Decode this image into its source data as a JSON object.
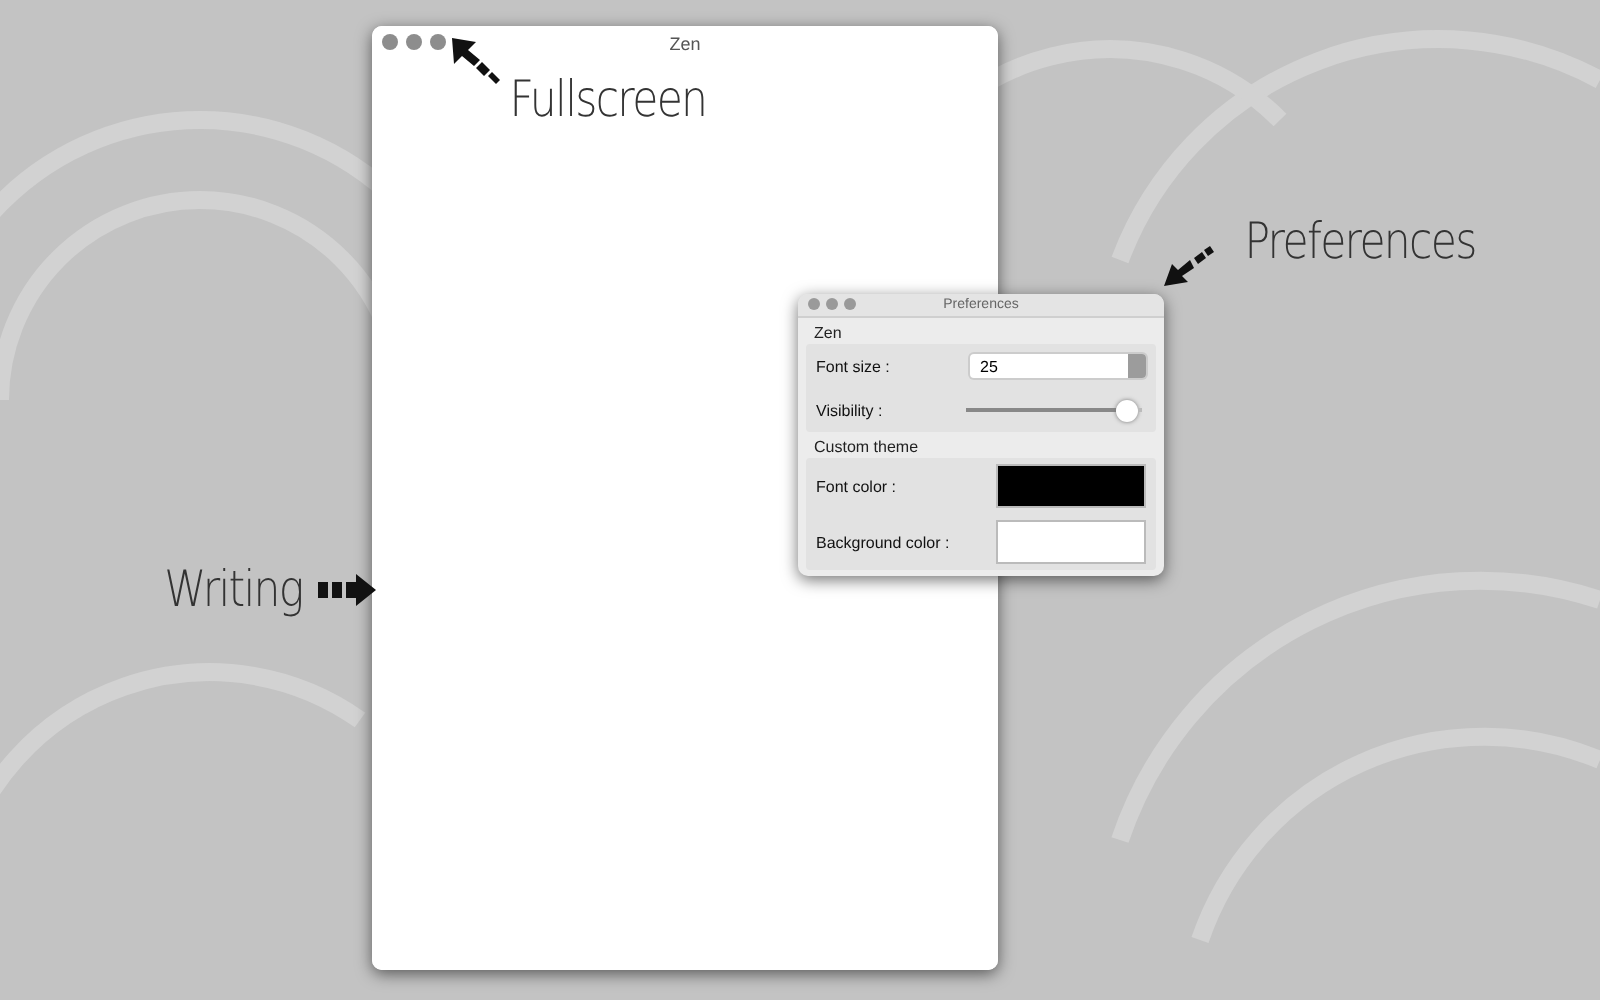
{
  "main_window": {
    "title": "Zen"
  },
  "preferences_window": {
    "title": "Preferences",
    "sections": [
      {
        "heading": "Zen",
        "rows": [
          {
            "kind": "stepper",
            "label": "Font size :",
            "value": "25"
          },
          {
            "kind": "slider",
            "label": "Visibility :",
            "level": 0.98
          }
        ]
      },
      {
        "heading": "Custom theme",
        "rows": [
          {
            "kind": "color",
            "label": "Font color :",
            "color": "#000000"
          },
          {
            "kind": "color",
            "label": "Background color :",
            "color": "#ffffff"
          }
        ]
      }
    ]
  },
  "annotations": [
    {
      "label": "Fullscreen",
      "kind": "up-left"
    },
    {
      "label": "Preferences",
      "kind": "down-left"
    },
    {
      "label": "Writing",
      "kind": "right"
    }
  ]
}
